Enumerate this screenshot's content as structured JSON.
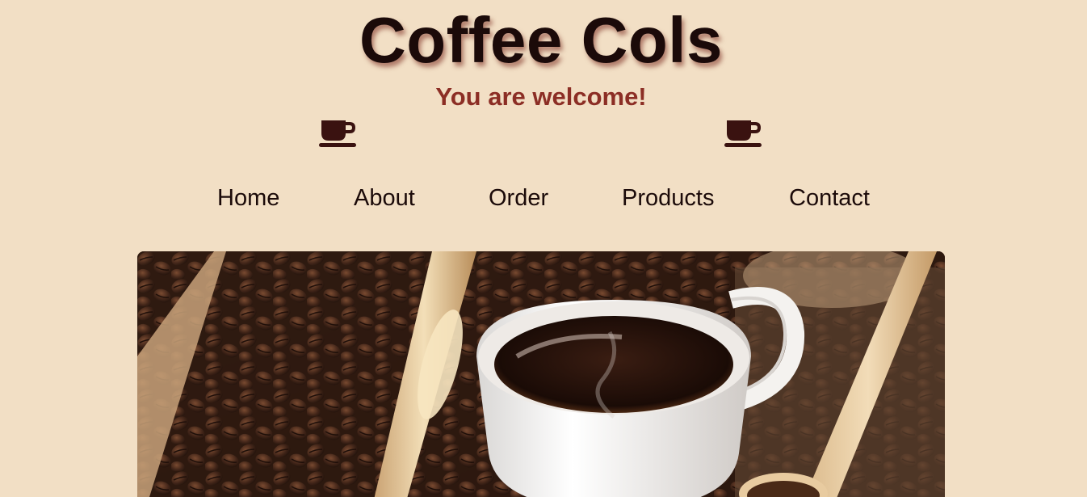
{
  "header": {
    "title": "Coffee Cols",
    "subtitle": "You are welcome!"
  },
  "icons": {
    "left": "coffee-cup-icon",
    "right": "coffee-cup-icon"
  },
  "nav": {
    "items": [
      {
        "label": "Home"
      },
      {
        "label": "About"
      },
      {
        "label": "Order"
      },
      {
        "label": "Products"
      },
      {
        "label": "Contact"
      }
    ]
  },
  "hero": {
    "image": "coffee-cup-and-beans-photo"
  },
  "colors": {
    "background": "#f2dfc5",
    "title": "#1b0a09",
    "subtitle": "#8c2e25",
    "icon": "#3a1210"
  }
}
